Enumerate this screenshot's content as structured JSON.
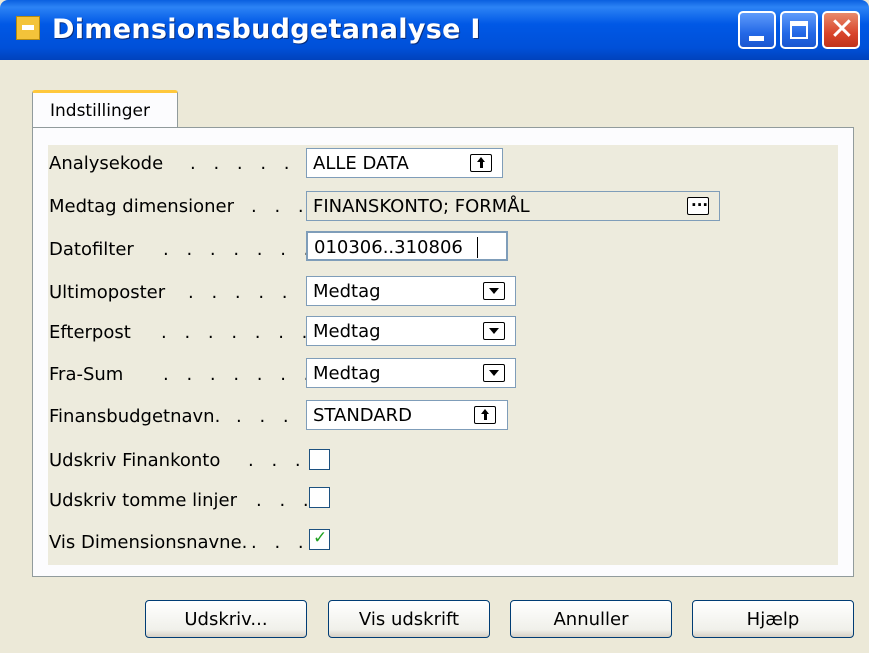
{
  "window": {
    "title": "Dimensionsbudgetanalyse I",
    "app_icon": "form-icon"
  },
  "tabs": [
    {
      "label": "Indstillinger",
      "active": true
    }
  ],
  "fields": {
    "analysekode": {
      "label": "Analysekode",
      "dots": ". . . . . . .",
      "value": "ALLE DATA",
      "control": "lookup"
    },
    "medtag": {
      "label": "Medtag dimensioner",
      "dots": ". . .",
      "value": "FINANSKONTO; FORMÅL",
      "control": "ellipsis"
    },
    "datofilter": {
      "label": "Datofilter",
      "dots": ". . . . . . . .",
      "value": "010306..310806",
      "control": "text"
    },
    "ultimo": {
      "label": "Ultimoposter",
      "dots": ". . . . . .",
      "value": "Medtag",
      "control": "dropdown"
    },
    "efterpost": {
      "label": "Efterpost",
      "dots": ". . . . . . .",
      "value": "Medtag",
      "control": "dropdown"
    },
    "frasum": {
      "label": "Fra-Sum",
      "dots": ". . . . . . . .",
      "value": "Medtag",
      "control": "dropdown"
    },
    "finansbudget": {
      "label": "Finansbudgetnavn.",
      "dots": ". . .",
      "value": "STANDARD",
      "control": "lookup"
    },
    "udskriv_finan": {
      "label": "Udskriv Finankonto",
      "dots": ". . .",
      "checked": false
    },
    "udskriv_tomme": {
      "label": "Udskriv tomme linjer",
      "dots": ". . .",
      "checked": false
    },
    "vis_dim": {
      "label": "Vis Dimensionsnavne.",
      "dots": ". . .",
      "checked": true
    }
  },
  "buttons": {
    "print": "Udskriv...",
    "preview": "Vis udskrift",
    "cancel": "Annuller",
    "help": "Hjælp"
  }
}
